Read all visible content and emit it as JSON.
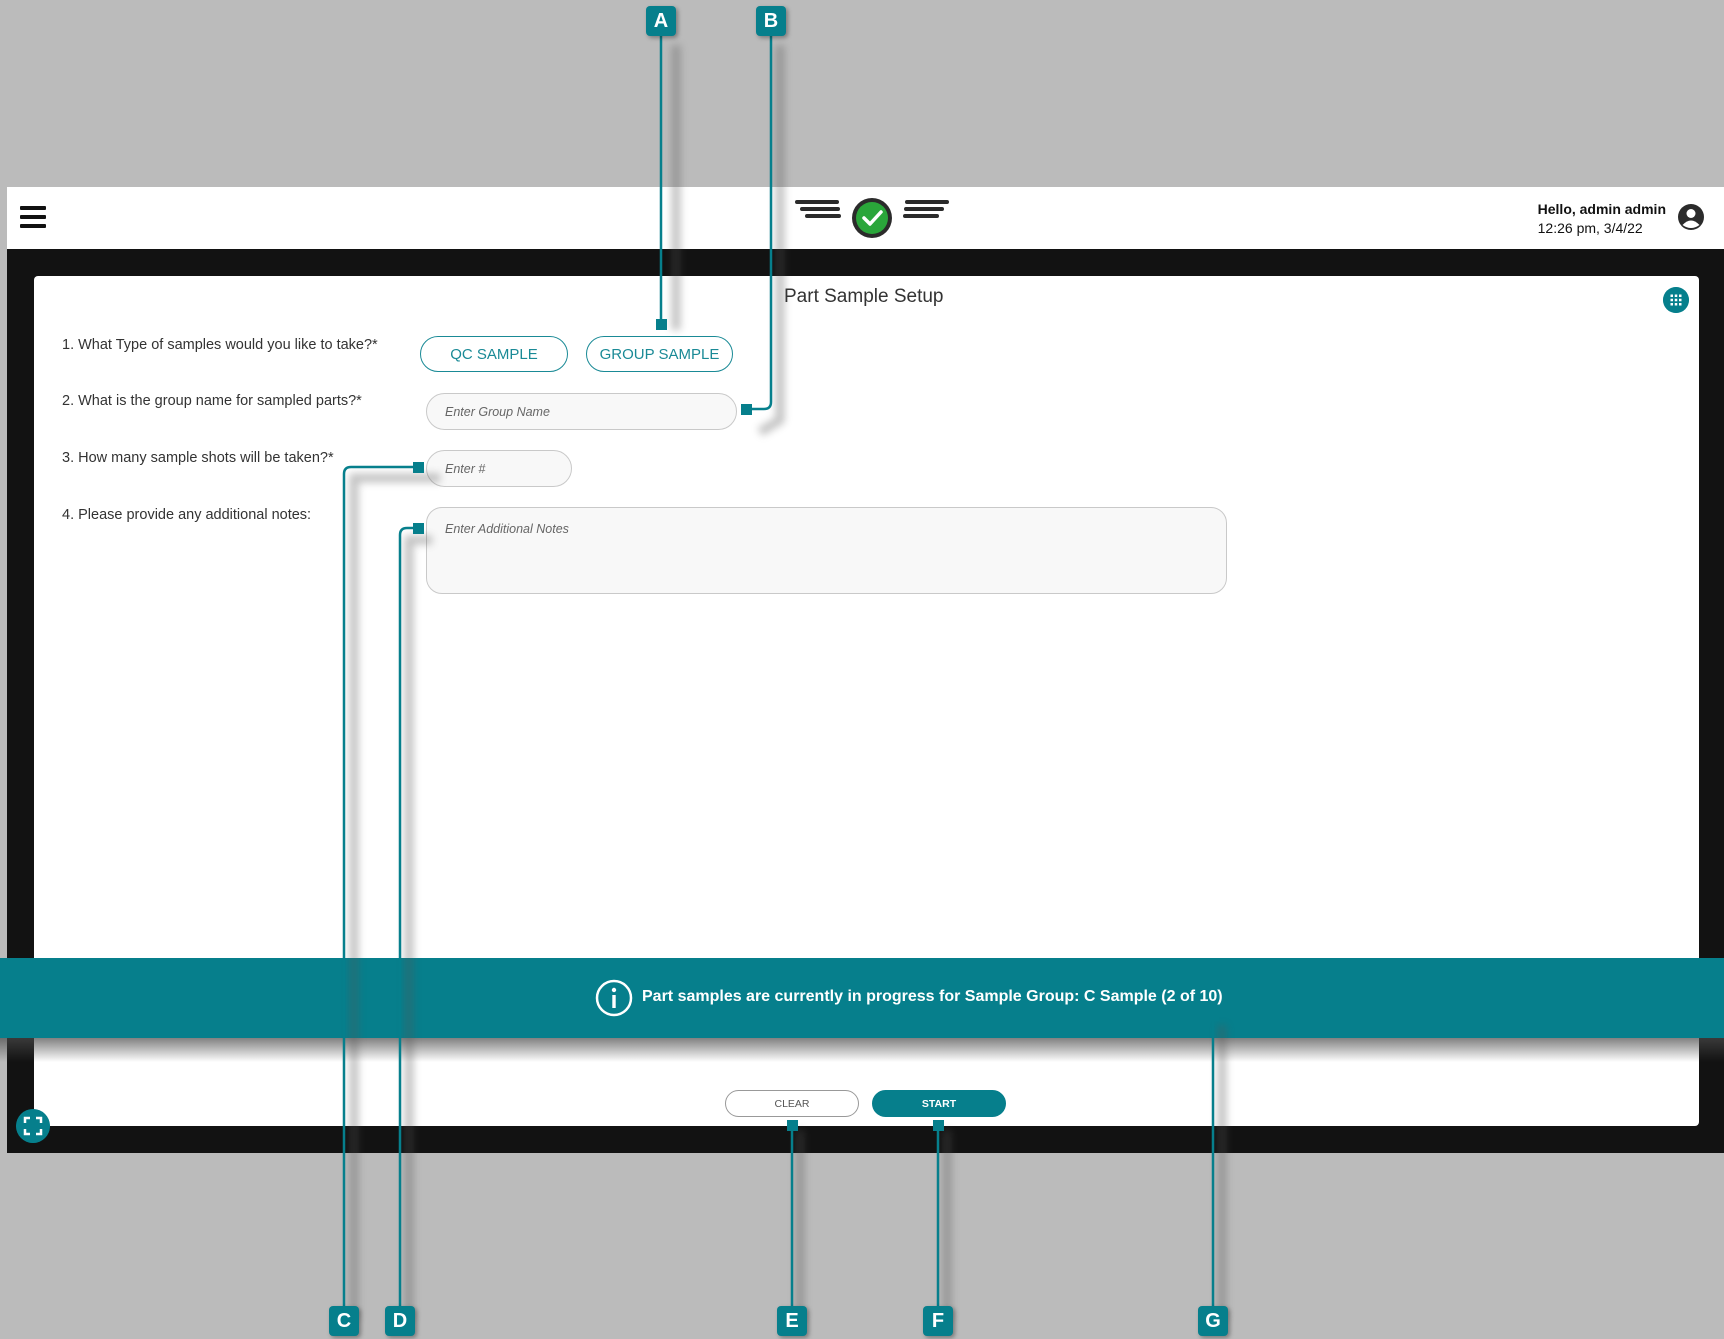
{
  "header": {
    "greeting": "Hello, admin admin",
    "datetime": "12:26 pm, 3/4/22"
  },
  "page": {
    "title": "Part Sample Setup"
  },
  "form": {
    "q1": {
      "label": "1. What Type of samples would you like to take?*",
      "options": [
        "QC SAMPLE",
        "GROUP SAMPLE"
      ]
    },
    "q2": {
      "label": "2. What is the group name for sampled parts?*",
      "placeholder": "Enter Group Name"
    },
    "q3": {
      "label": "3. How many sample shots will be taken?*",
      "placeholder": "Enter #"
    },
    "q4": {
      "label": "4. Please provide any additional notes:",
      "placeholder": "Enter Additional Notes"
    }
  },
  "banner": {
    "text": "Part samples are currently in progress for Sample Group: C Sample (2 of 10)"
  },
  "actions": {
    "clear_label": "CLEAR",
    "start_label": "START"
  },
  "callouts": [
    "A",
    "B",
    "C",
    "D",
    "E",
    "F",
    "G"
  ],
  "colors": {
    "teal": "#067f8c",
    "frame": "#121212",
    "background": "#bbbbbb",
    "logo_check": "#2aa63a"
  },
  "icons": {
    "menu": "hamburger-icon",
    "user": "account-circle-icon",
    "apps": "grid-icon",
    "info": "info-icon",
    "fullscreen": "fullscreen-icon",
    "logo": "winged-check-logo"
  }
}
